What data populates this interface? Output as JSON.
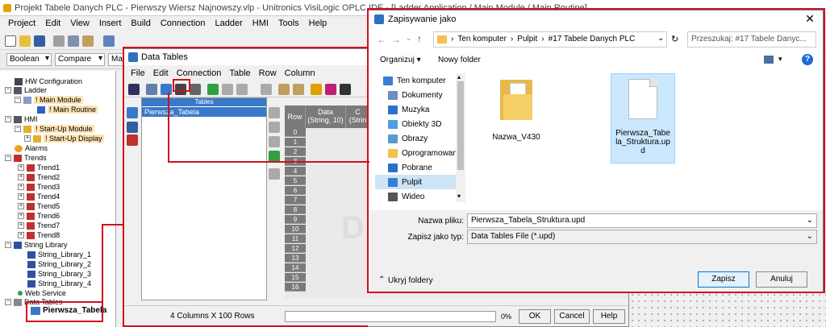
{
  "ide": {
    "title": "Projekt Tabele Danych PLC - Pierwszy Wiersz Najnowszy.vlp - Unitronics VisiLogic OPLC IDE - [Ladder Application / Main Module / Main Routine]",
    "menu": [
      "Project",
      "Edit",
      "View",
      "Insert",
      "Build",
      "Connection",
      "Ladder",
      "HMI",
      "Tools",
      "Help"
    ],
    "combos": [
      "Boolean",
      "Compare",
      "Math"
    ]
  },
  "tree": {
    "items": [
      {
        "label": "HW Configuration"
      },
      {
        "label": "Ladder"
      },
      {
        "label": "! Main Module"
      },
      {
        "label": "! Main Routine"
      },
      {
        "label": "HMI"
      },
      {
        "label": "! Start-Up Module"
      },
      {
        "label": "! Start-Up Display"
      },
      {
        "label": "Alarms"
      },
      {
        "label": "Trends"
      },
      {
        "label": "Trend1"
      },
      {
        "label": "Trend2"
      },
      {
        "label": "Trend3"
      },
      {
        "label": "Trend4"
      },
      {
        "label": "Trend5"
      },
      {
        "label": "Trend6"
      },
      {
        "label": "Trend7"
      },
      {
        "label": "Trend8"
      },
      {
        "label": "String Library"
      },
      {
        "label": "String_Library_1"
      },
      {
        "label": "String_Library_2"
      },
      {
        "label": "String_Library_3"
      },
      {
        "label": "String_Library_4"
      },
      {
        "label": "Web Service"
      },
      {
        "label": "Data Tables"
      },
      {
        "label": "Pierwsza_Tabela"
      }
    ]
  },
  "data_tables": {
    "title": "Data Tables",
    "menu": [
      "File",
      "Edit",
      "Connection",
      "Table",
      "Row",
      "Column"
    ],
    "tables_header": "Tables",
    "tables": [
      "Pierwsza_Tabela"
    ],
    "grid_headers": [
      "Row",
      "Data\n(String, 10)",
      "C\n(Strin"
    ],
    "rows": [
      "0",
      "1",
      "2",
      "3",
      "4",
      "5",
      "6",
      "7",
      "8",
      "9",
      "10",
      "11",
      "12",
      "13",
      "14",
      "15",
      "16"
    ],
    "status": "4 Columns X 100 Rows",
    "progress": "0%",
    "ok_label": "OK",
    "cancel_label": "Cancel",
    "help_label": "Help",
    "watermark": "D"
  },
  "save_dialog": {
    "title": "Zapisywanie jako",
    "breadcrumb": [
      "Ten komputer",
      "Pulpit",
      "#17 Tabele Danych PLC"
    ],
    "search_placeholder": "Przeszukaj: #17 Tabele Danyc...",
    "organize_label": "Organizuj ▾",
    "new_folder_label": "Nowy folder",
    "nav_items": [
      {
        "label": "Ten komputer",
        "color": "#3a7bd5"
      },
      {
        "label": "Dokumenty",
        "color": "#6a8fc0"
      },
      {
        "label": "Muzyka",
        "color": "#2a72c8"
      },
      {
        "label": "Obiekty 3D",
        "color": "#4aa0e0"
      },
      {
        "label": "Obrazy",
        "color": "#5a9ad0"
      },
      {
        "label": "Oprogramowani",
        "color": "#f2c24a"
      },
      {
        "label": "Pobrane",
        "color": "#2a72c8"
      },
      {
        "label": "Pulpit",
        "color": "#3a7bd5"
      },
      {
        "label": "Wideo",
        "color": "#555555"
      }
    ],
    "files": [
      {
        "name": "Nazwa_V430",
        "kind": "folder"
      },
      {
        "name": "Pierwsza_Tabela_Struktura.upd",
        "kind": "file"
      }
    ],
    "filename_label": "Nazwa pliku:",
    "filename_value": "Pierwsza_Tabela_Struktura.upd",
    "filetype_label": "Zapisz jako typ:",
    "filetype_value": "Data Tables File (*.upd)",
    "hide_folders_label": "Ukryj foldery",
    "save_label": "Zapisz",
    "cancel_label": "Anuluj"
  }
}
